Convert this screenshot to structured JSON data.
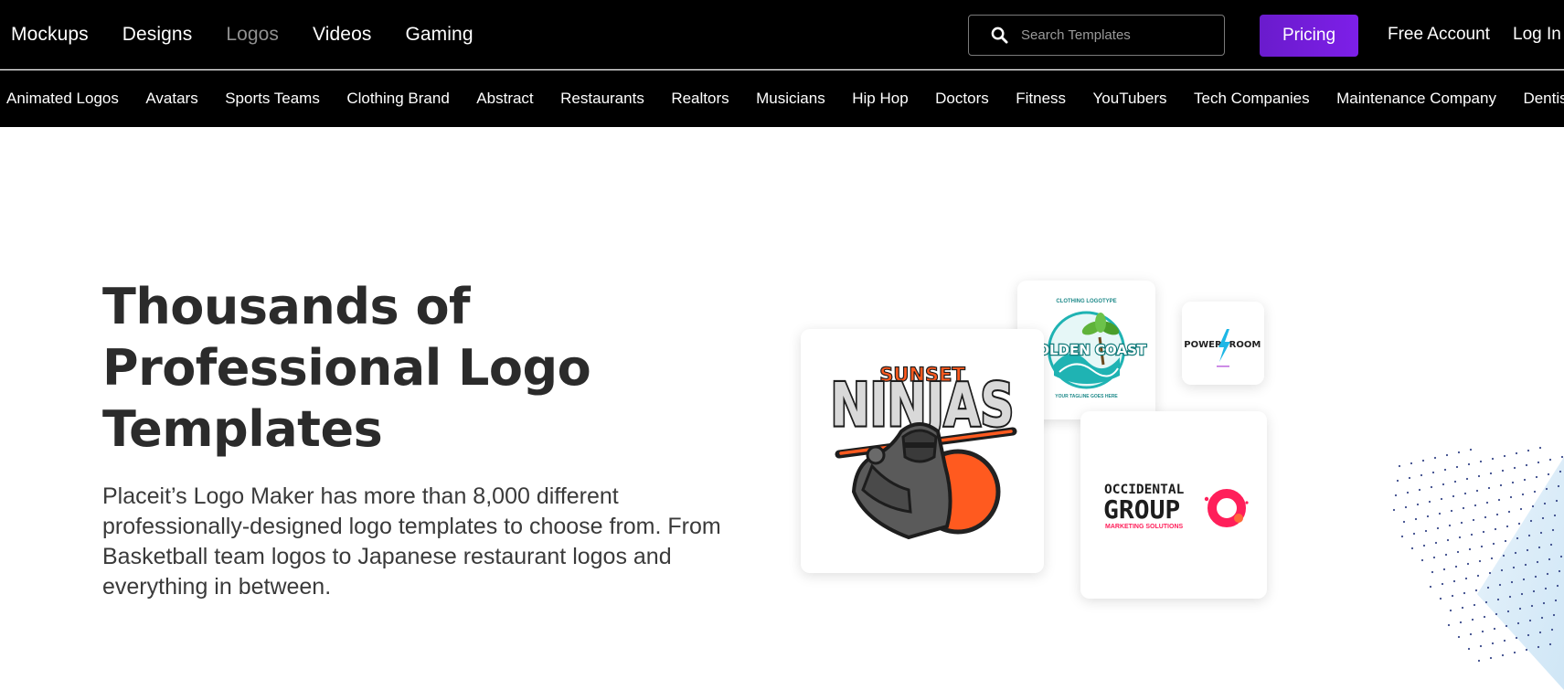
{
  "nav": {
    "items": [
      {
        "label": "Mockups",
        "active": false
      },
      {
        "label": "Designs",
        "active": false
      },
      {
        "label": "Logos",
        "active": true
      },
      {
        "label": "Videos",
        "active": false
      },
      {
        "label": "Gaming",
        "active": false
      }
    ],
    "search_placeholder": "Search Templates",
    "pricing_label": "Pricing",
    "free_account_label": "Free Account",
    "login_label": "Log In"
  },
  "categories": [
    "Animated Logos",
    "Avatars",
    "Sports Teams",
    "Clothing Brand",
    "Abstract",
    "Restaurants",
    "Realtors",
    "Musicians",
    "Hip Hop",
    "Doctors",
    "Fitness",
    "YouTubers",
    "Tech Companies",
    "Maintenance Company",
    "Dentists"
  ],
  "hero": {
    "title_lines": [
      "Thousands of",
      "Professional Logo",
      "Templates"
    ],
    "description": "Placeit’s Logo Maker has more than 8,000 different professionally-designed logo templates to choose from. From Basketball team logos to Japanese restaurant logos and everything in between."
  },
  "logos": {
    "ninjas": {
      "top": "SUNSET",
      "main": "NINJAS"
    },
    "golden": {
      "top": "CLOTHING LOGOTYPE",
      "main": "GOLDEN COAST",
      "bottom": "YOUR TAGLINE GOES HERE"
    },
    "power": {
      "left": "POWER",
      "right": "ROOM"
    },
    "occidental": {
      "line1": "OCCIDENTAL",
      "line2": "GROUP",
      "line3": "MARKETING SOLUTIONS"
    }
  },
  "colors": {
    "accent_purple": "#7d1fe8",
    "ninja_orange": "#ff5a1f",
    "teal": "#1fb3b3",
    "occidental_red": "#ff1f5a"
  }
}
